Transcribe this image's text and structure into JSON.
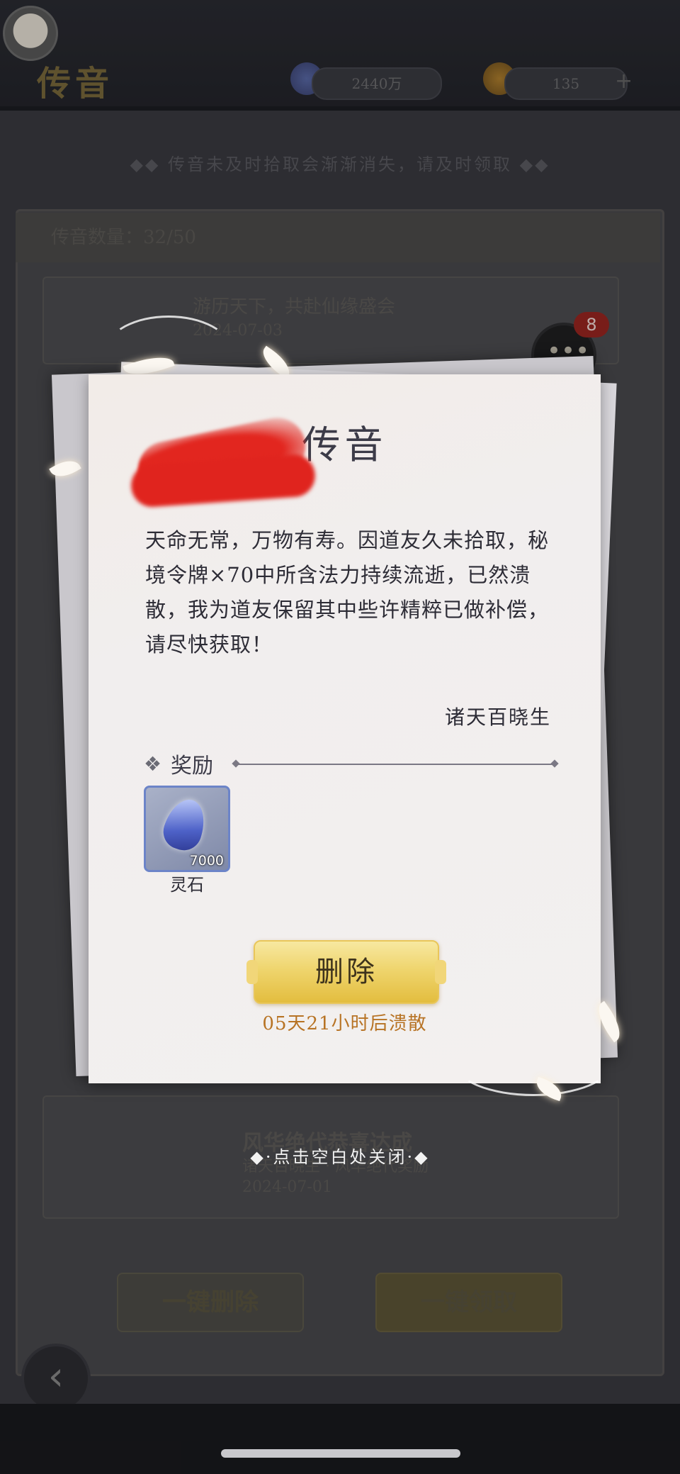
{
  "background": {
    "screen_title": "传音",
    "resource_left": "2440万",
    "resource_right": "135",
    "hint": "◆◆ 传音未及时拾取会渐渐消失，请及时领取 ◆◆",
    "mail_count_label": "传音数量：32/50",
    "row1_line1": "游历天下，共赴仙缘盛会",
    "row1_line2": "2024-07-03",
    "row2_line1": "风华绝代恭喜达成",
    "row2_line2": "诸天百晓生 · 风华绝代奖励",
    "row2_line3": "2024-07-01",
    "chat_badge": "8",
    "delete_all_button": "一键删除",
    "claim_all_button": "一键领取"
  },
  "letter": {
    "title": "传音",
    "body": "天命无常，万物有寿。因道友久未拾取，秘境令牌×70中所含法力持续流逝，已然溃散，我为道友保留其中些许精粹已做补偿，请尽快获取！",
    "signature": "诸天百晓生",
    "reward_label": "奖励",
    "reward_item": {
      "name": "灵石",
      "count": "7000",
      "icon": "spirit-stone-icon"
    },
    "delete_button": "删除",
    "expire_text": "05天21小时后溃散"
  },
  "close_hint": "◆·点击空白处关闭·◆",
  "colors": {
    "accent_gold": "#efd56e",
    "expire_orange": "#b77324",
    "badge_red": "#9a2621",
    "redaction_red": "#e0241e"
  }
}
